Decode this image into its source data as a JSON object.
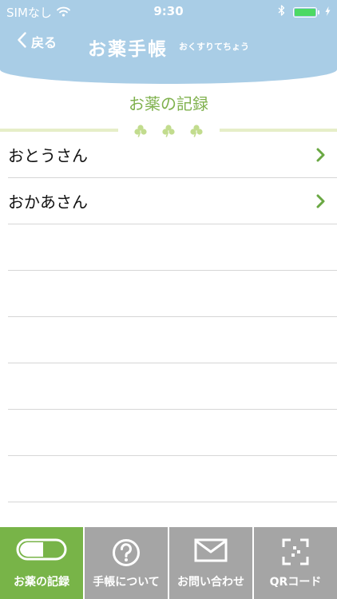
{
  "status_bar": {
    "carrier": "SIMなし",
    "time": "9:30",
    "wifi_icon": "wifi-icon",
    "bluetooth_icon": "bluetooth-icon",
    "battery_level": 1.0,
    "battery_color": "#4cd964"
  },
  "nav": {
    "back_label": "戻る",
    "title": "お薬手帳",
    "subtitle": "おくすりてちょう"
  },
  "section": {
    "title": "お薬の記録"
  },
  "list": {
    "items": [
      {
        "label": "おとうさん"
      },
      {
        "label": "おかあさん"
      }
    ]
  },
  "tabbar": {
    "tabs": [
      {
        "label": "お薬の記録",
        "icon": "pill-icon",
        "active": true
      },
      {
        "label": "手帳について",
        "icon": "question-icon",
        "active": false
      },
      {
        "label": "お問い合わせ",
        "icon": "mail-icon",
        "active": false
      },
      {
        "label": "QRコード",
        "icon": "qr-scan-icon",
        "active": false
      }
    ]
  },
  "colors": {
    "header": "#a9cde6",
    "accent_green": "#7fb14d",
    "tab_active": "#78b448",
    "tab_inactive": "#a5a5a5"
  }
}
